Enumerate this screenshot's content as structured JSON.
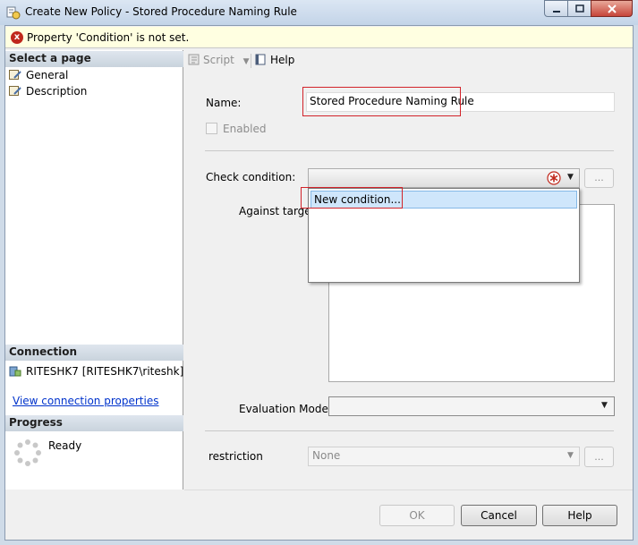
{
  "window": {
    "title": "Create New Policy - Stored Procedure Naming Rule",
    "min_label": "▭",
    "max_label": "▢",
    "close_label": "x"
  },
  "error": {
    "icon_glyph": "x",
    "message": "Property 'Condition' is not set."
  },
  "left": {
    "select_page_header": "Select a page",
    "pages": [
      {
        "label": "General",
        "icon": "page-icon"
      },
      {
        "label": "Description",
        "icon": "page-icon"
      }
    ],
    "connection_header": "Connection",
    "connection_value": "RITESHK7 [RITESHK7\\riteshk]",
    "connection_link": "View connection properties",
    "progress_header": "Progress",
    "progress_status": "Ready"
  },
  "toolbar": {
    "script_label": "Script",
    "help_label": "Help"
  },
  "form": {
    "name_label": "Name:",
    "name_value": "Stored Procedure Naming Rule",
    "enabled_label": "Enabled",
    "check_condition_label": "Check condition:",
    "check_condition_value": "",
    "against_targets_label": "Against targets:",
    "evaluation_mode_label": "Evaluation Mode:",
    "evaluation_mode_value": "",
    "restriction_label": "restriction",
    "restriction_value": "None",
    "ellipsis_label": "...",
    "dropdown_items": [
      "New condition..."
    ]
  },
  "buttons": {
    "ok": "OK",
    "cancel": "Cancel",
    "help": "Help"
  },
  "colors": {
    "error_red": "#c0281c",
    "highlight_red": "#d2232a",
    "selection_blue": "#cfe6fb"
  }
}
